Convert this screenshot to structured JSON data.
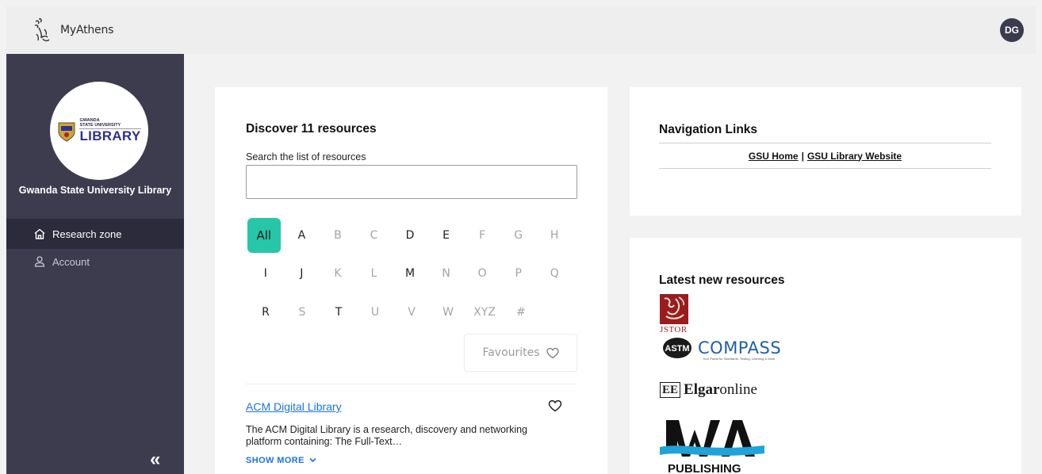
{
  "app": {
    "name": "MyAthens",
    "user_initials": "DG"
  },
  "sidebar": {
    "library_name": "Gwanda State University Library",
    "logo_text_small_1": "GWANDA",
    "logo_text_small_2": "STATE UNIVERSITY",
    "logo_text_big": "LIBRARY",
    "items": [
      {
        "label": "Research zone",
        "icon": "home-icon",
        "active": true
      },
      {
        "label": "Account",
        "icon": "user-icon",
        "active": false
      }
    ],
    "collapse_glyph": "«"
  },
  "discover": {
    "title": "Discover 11 resources",
    "search_label": "Search the list of resources",
    "search_value": "",
    "letters_row1": [
      {
        "label": "All",
        "state": "selected"
      },
      {
        "label": "A",
        "state": "on"
      },
      {
        "label": "B",
        "state": "off"
      },
      {
        "label": "C",
        "state": "off"
      },
      {
        "label": "D",
        "state": "on"
      },
      {
        "label": "E",
        "state": "on"
      },
      {
        "label": "F",
        "state": "off"
      },
      {
        "label": "G",
        "state": "off"
      },
      {
        "label": "H",
        "state": "off"
      }
    ],
    "letters_row2": [
      {
        "label": "I",
        "state": "on"
      },
      {
        "label": "J",
        "state": "on"
      },
      {
        "label": "K",
        "state": "off"
      },
      {
        "label": "L",
        "state": "off"
      },
      {
        "label": "M",
        "state": "on"
      },
      {
        "label": "N",
        "state": "off"
      },
      {
        "label": "O",
        "state": "off"
      },
      {
        "label": "P",
        "state": "off"
      },
      {
        "label": "Q",
        "state": "off"
      }
    ],
    "letters_row3": [
      {
        "label": "R",
        "state": "on"
      },
      {
        "label": "S",
        "state": "off"
      },
      {
        "label": "T",
        "state": "on"
      },
      {
        "label": "U",
        "state": "off"
      },
      {
        "label": "V",
        "state": "off"
      },
      {
        "label": "W",
        "state": "off"
      },
      {
        "label": "XYZ",
        "state": "off"
      },
      {
        "label": "#",
        "state": "off"
      }
    ],
    "favourites_label": "Favourites",
    "resource": {
      "title": "ACM Digital Library",
      "description": "The ACM Digital Library is a research, discovery and networking platform containing: The Full-Text…",
      "show_more": "SHOW MORE"
    }
  },
  "navigation": {
    "title": "Navigation Links",
    "links": [
      {
        "label": "GSU Home"
      },
      {
        "label": "GSU Library Website"
      }
    ],
    "separator": "|"
  },
  "latest": {
    "title": "Latest new resources",
    "jstor_label": "JSTOR",
    "astm_compass": "COMPASS",
    "astm_sub": "Your Portal for Standards, Testing, Learning & More",
    "elgar_box": "EE",
    "elgar_bold": "Elgar",
    "elgar_rest": "online",
    "iwa_text": "PUBLISHING"
  },
  "colors": {
    "sidebar_bg": "#3d3c4f",
    "sidebar_active_bg": "#2c2b3c",
    "accent_teal": "#28c6a8",
    "link_blue": "#1a73e8"
  }
}
